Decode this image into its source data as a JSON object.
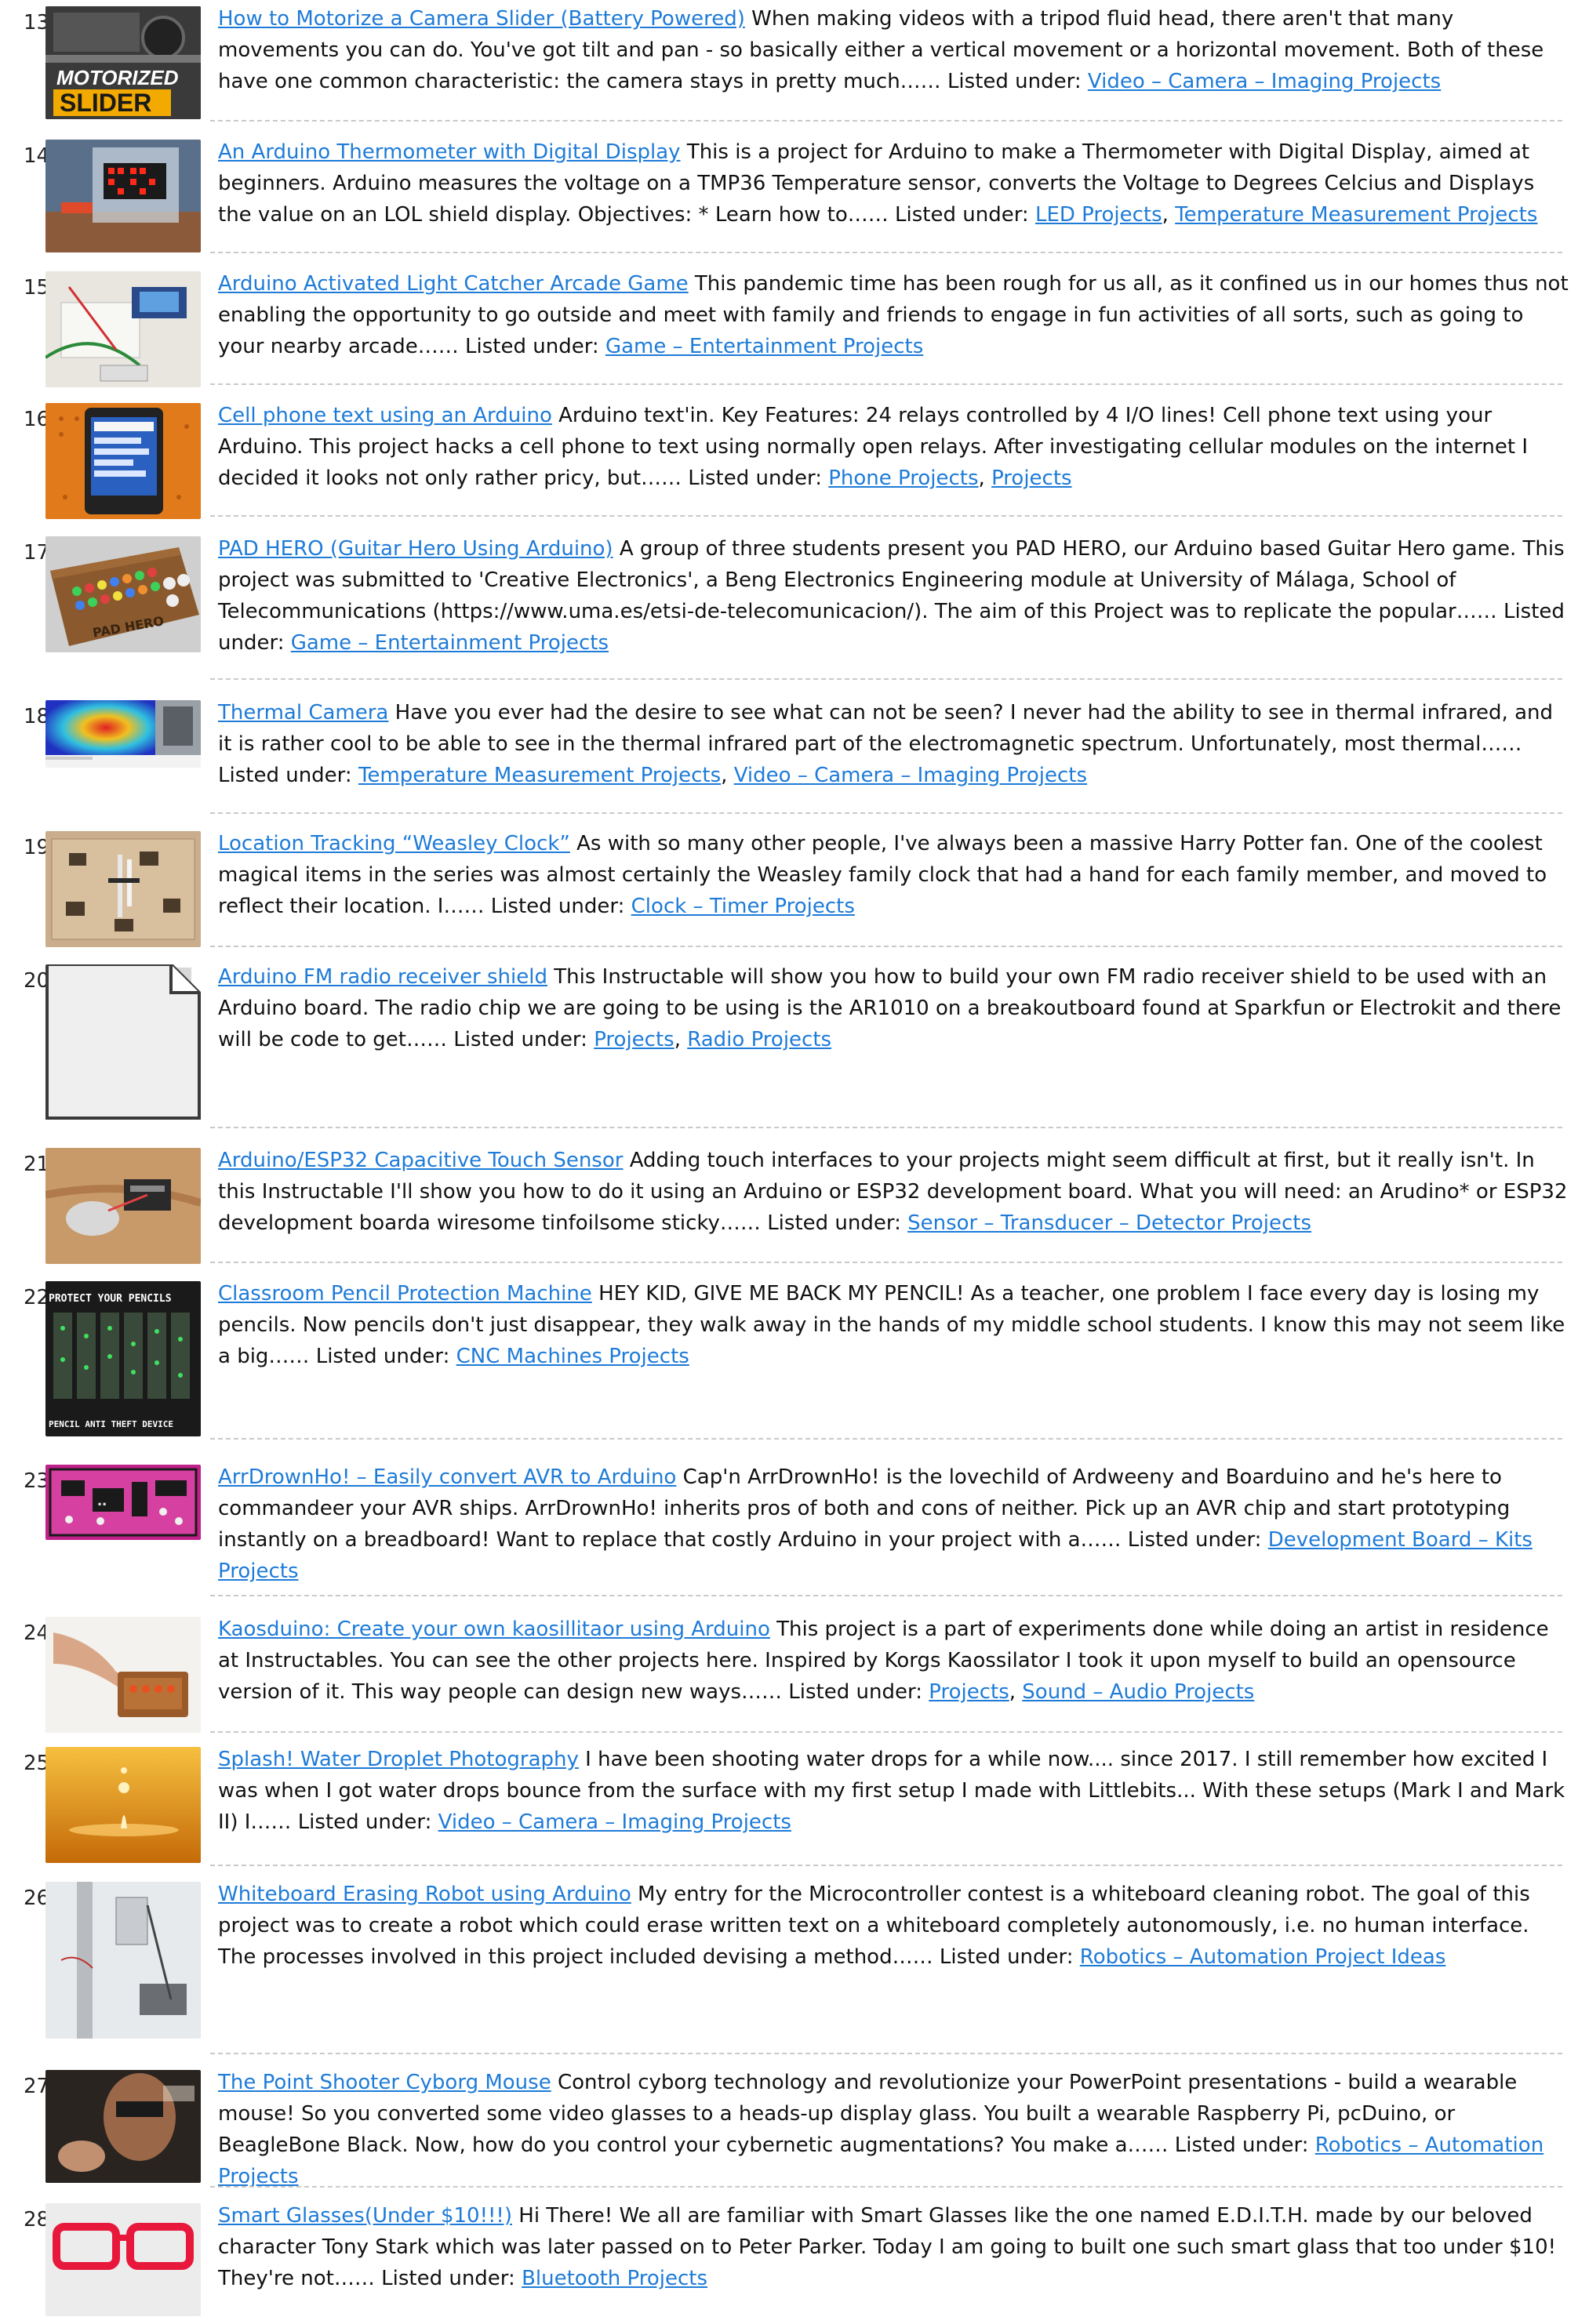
{
  "listed_prefix": "Listed under:",
  "items": [
    {
      "num": "13.",
      "title": "How to Motorize a Camera Slider (Battery Powered)",
      "desc": " When making videos with a tripod fluid head, there aren't that many movements you can do. You've got tilt and pan - so basically either a vertical movement or a horizontal movement. Both of these have one common characteristic: the camera stays in pretty much…… ",
      "cats": [
        "Video – Camera – Imaging Projects"
      ],
      "thumb_text": [
        "MOTORIZED",
        "SLIDER"
      ]
    },
    {
      "num": "14.",
      "title": "An Arduino Thermometer with Digital Display",
      "desc": " This is a project for Arduino to make a Thermometer with Digital Display, aimed at beginners. Arduino measures the voltage on a TMP36 Temperature sensor, converts the Voltage to Degrees Celcius and Displays the value on an LOL shield display. Objectives: * Learn how to…… ",
      "cats": [
        "LED Projects",
        "Temperature Measurement Projects"
      ]
    },
    {
      "num": "15.",
      "title": "Arduino Activated Light Catcher Arcade Game",
      "desc": " This pandemic time has been rough for us all, as it confined us in our homes thus not enabling the opportunity to go outside and meet with family and friends to engage in fun activities of all sorts, such as going to your nearby arcade…… ",
      "cats": [
        "Game – Entertainment Projects"
      ]
    },
    {
      "num": "16.",
      "title": "Cell phone text using an Arduino",
      "desc": " Arduino text'in. Key Features: 24 relays controlled by 4 I/O lines! Cell phone text using your Arduino. This project hacks a cell phone to text using normally open relays. After investigating cellular modules on the internet I decided it looks not only rather pricy, but…… ",
      "cats": [
        "Phone Projects",
        "Projects"
      ]
    },
    {
      "num": "17.",
      "title": "PAD HERO (Guitar Hero Using Arduino)",
      "desc": " A group of three students present you PAD HERO, our Arduino based Guitar Hero game. This project was submitted to 'Creative Electronics', a Beng Electronics Engineering module at University of Málaga, School of Telecommunications (https://www.uma.es/etsi-de-telecomunicacion/). The aim of this Project was to replicate the popular…… ",
      "cats": [
        "Game – Entertainment Projects"
      ],
      "thumb_text": [
        "PAD HERO"
      ]
    },
    {
      "num": "18.",
      "title": "Thermal Camera",
      "desc": " Have you ever had the desire to see what can not be seen? I never had the ability to see in thermal infrared, and it is rather cool to be able to see in the thermal infrared part of the electromagnetic spectrum. Unfortunately, most thermal…… ",
      "cats": [
        "Temperature Measurement Projects",
        "Video – Camera – Imaging Projects"
      ]
    },
    {
      "num": "19.",
      "title": "Location Tracking “Weasley Clock”",
      "desc": " As with so many other people, I've always been a massive Harry Potter fan. One of the coolest magical items in the series was almost certainly the Weasley family clock that had a hand for each family member, and moved to reflect their location. I…… ",
      "cats": [
        "Clock – Timer Projects"
      ]
    },
    {
      "num": "20.",
      "title": "Arduino FM radio receiver shield",
      "desc": " This Instructable will show you how to build your own FM radio receiver shield to be used with an Arduino board. The radio chip we are going to be using is the AR1010 on a breakoutboard found at Sparkfun or Electrokit and there will be code to get…… ",
      "cats": [
        "Projects",
        "Radio Projects"
      ]
    },
    {
      "num": "21.",
      "title": "Arduino/ESP32 Capacitive Touch Sensor",
      "desc": " Adding touch interfaces to your projects might seem difficult at first, but it really isn't. In this Instructable I'll show you how to do it using an Arduino or ESP32 development board. What you will need: an Arudino* or ESP32 development boarda wiresome tinfoilsome sticky…… ",
      "cats": [
        "Sensor – Transducer – Detector Projects"
      ]
    },
    {
      "num": "22.",
      "title": "Classroom Pencil Protection Machine",
      "desc": " HEY KID, GIVE ME BACK MY PENCIL! As a teacher, one problem I face every day is losing my pencils. Now pencils don't just disappear, they walk away in the hands of my middle school students. I know this may not seem like a big…… ",
      "cats": [
        "CNC Machines Projects"
      ],
      "listed_break": true,
      "thumb_text": [
        "PROTECT YOUR PENCILS",
        "PENCIL ANTI THEFT DEVICE"
      ]
    },
    {
      "num": "23.",
      "title": "ArrDrownHo! – Easily convert AVR to Arduino",
      "desc": " Cap'n ArrDrownHo! is the lovechild of Ardweeny and Boarduino and he's here to commandeer your AVR ships. ArrDrownHo! inherits pros of both and cons of neither. Pick up an AVR chip and start prototyping instantly on a breadboard! Want to replace that costly Arduino in your project with a…… ",
      "cats": [
        "Development Board – Kits Projects"
      ]
    },
    {
      "num": "24.",
      "title": "Kaosduino: Create your own kaosillitaor using Arduino",
      "desc": " This project is a part of experiments done while doing an artist in residence at Instructables. You can see the other projects here. Inspired by Korgs Kaossilator I took it upon myself to build an opensource version of it. This way people can design new ways…… ",
      "cats": [
        "Projects",
        "Sound – Audio Projects"
      ]
    },
    {
      "num": "25.",
      "title": "Splash! Water Droplet Photography",
      "desc": " I have been shooting water drops for a while now.... since 2017. I still remember how excited I was when I got water drops bounce from the surface with my first setup I made with Littlebits... With these setups (Mark I and Mark II) I…… ",
      "cats": [
        "Video – Camera – Imaging Projects"
      ],
      "listed_break": true
    },
    {
      "num": "26.",
      "title": "Whiteboard Erasing Robot using Arduino",
      "desc": " My entry for the Microcontroller contest is a whiteboard cleaning robot. The goal of this project was to create a robot which could erase written text on a whiteboard completely autonomously, i.e. no human interface. The processes involved in this project included devising a method…… ",
      "cats": [
        "Robotics – Automation Project Ideas"
      ]
    },
    {
      "num": "27.",
      "title": "The Point Shooter Cyborg Mouse",
      "desc": " Control cyborg technology and revolutionize your PowerPoint presentations - build a wearable mouse! So you converted some video glasses to a heads-up display glass. You built a wearable Raspberry Pi, pcDuino, or BeagleBone Black. Now, how do you control your cybernetic augmentations? You make a…… ",
      "cats": [
        "Robotics – Automation Projects"
      ]
    },
    {
      "num": "28.",
      "title": "Smart Glasses(Under $10!!!)",
      "desc": " Hi There! We all are familiar with Smart Glasses like the one named E.D.I.T.H. made by our beloved character Tony Stark which was later passed on to Peter Parker. Today I am going to built one such smart glass that too under $10! They're not…… ",
      "cats": [
        "Bluetooth Projects"
      ]
    }
  ]
}
